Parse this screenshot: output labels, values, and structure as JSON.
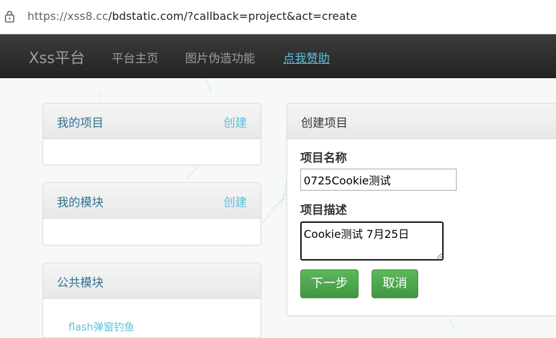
{
  "browser": {
    "url_host": "https://xss8.cc",
    "url_path": "/bdstatic.com/?callback=project&act=create"
  },
  "navbar": {
    "brand": "Xss平台",
    "links": [
      {
        "label": "平台主页"
      },
      {
        "label": "图片伪造功能"
      },
      {
        "label": "点我赞助"
      }
    ]
  },
  "sidebar": {
    "my_projects": {
      "title": "我的项目",
      "action": "创建"
    },
    "my_modules": {
      "title": "我的模块",
      "action": "创建"
    },
    "public_modules": {
      "title": "公共模块",
      "first_item": "flash弹窗钓鱼"
    }
  },
  "create_project": {
    "title": "创建项目",
    "name_label": "项目名称",
    "name_value": "0725Cookie测试",
    "desc_label": "项目描述",
    "desc_value": "Cookie测试 7月25日",
    "next_button": "下一步",
    "cancel_button": "取消"
  },
  "colors": {
    "navbar": "#222222",
    "link_info": "#5bc0de",
    "panel_title": "#31708f",
    "button_success": "#5cb85c"
  }
}
